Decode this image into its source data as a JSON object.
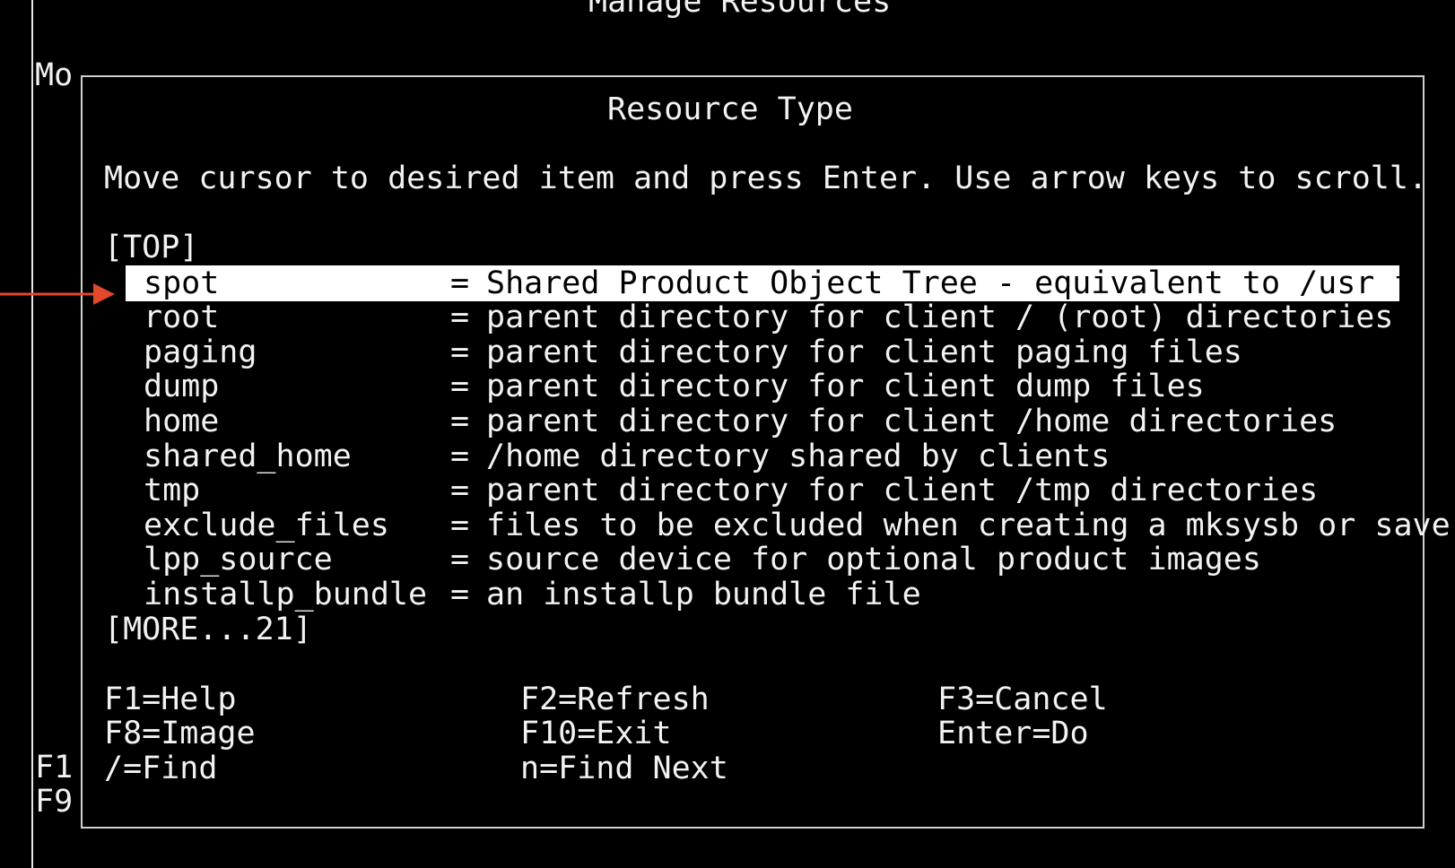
{
  "screen": {
    "title": "Manage Resources",
    "left_fragment": "Mo",
    "bottom_left_f1": "F1",
    "bottom_left_f9": "F9"
  },
  "dialog": {
    "title": "Resource Type",
    "instruction": "Move cursor to desired item and press Enter. Use arrow keys to scroll.",
    "top_marker": "[TOP]",
    "more_marker": "[MORE...21]",
    "items": [
      {
        "key": "spot",
        "desc": "Shared Product Object Tree - equivalent to /usr fil",
        "selected": true
      },
      {
        "key": "root",
        "desc": "parent directory for client / (root) directories"
      },
      {
        "key": "paging",
        "desc": "parent directory for client paging files"
      },
      {
        "key": "dump",
        "desc": "parent directory for client dump files"
      },
      {
        "key": "home",
        "desc": "parent directory for client /home directories"
      },
      {
        "key": "shared_home",
        "desc": "/home directory shared by clients"
      },
      {
        "key": "tmp",
        "desc": "parent directory for client /tmp directories"
      },
      {
        "key": "exclude_files",
        "desc": "files to be excluded when creating a mksysb or save"
      },
      {
        "key": "lpp_source",
        "desc": "source device for optional product images"
      },
      {
        "key": "installp_bundle",
        "desc": "an installp bundle file"
      }
    ],
    "separator": "=",
    "fkeys": {
      "help": "F1=Help",
      "refresh": "F2=Refresh",
      "cancel": "F3=Cancel",
      "image": "F8=Image",
      "exit": "F10=Exit",
      "do": "Enter=Do",
      "find": "/=Find",
      "find_next": "n=Find Next"
    }
  },
  "annotation": {
    "arrow_color": "#e5472c",
    "icon": "arrow-right-icon"
  }
}
